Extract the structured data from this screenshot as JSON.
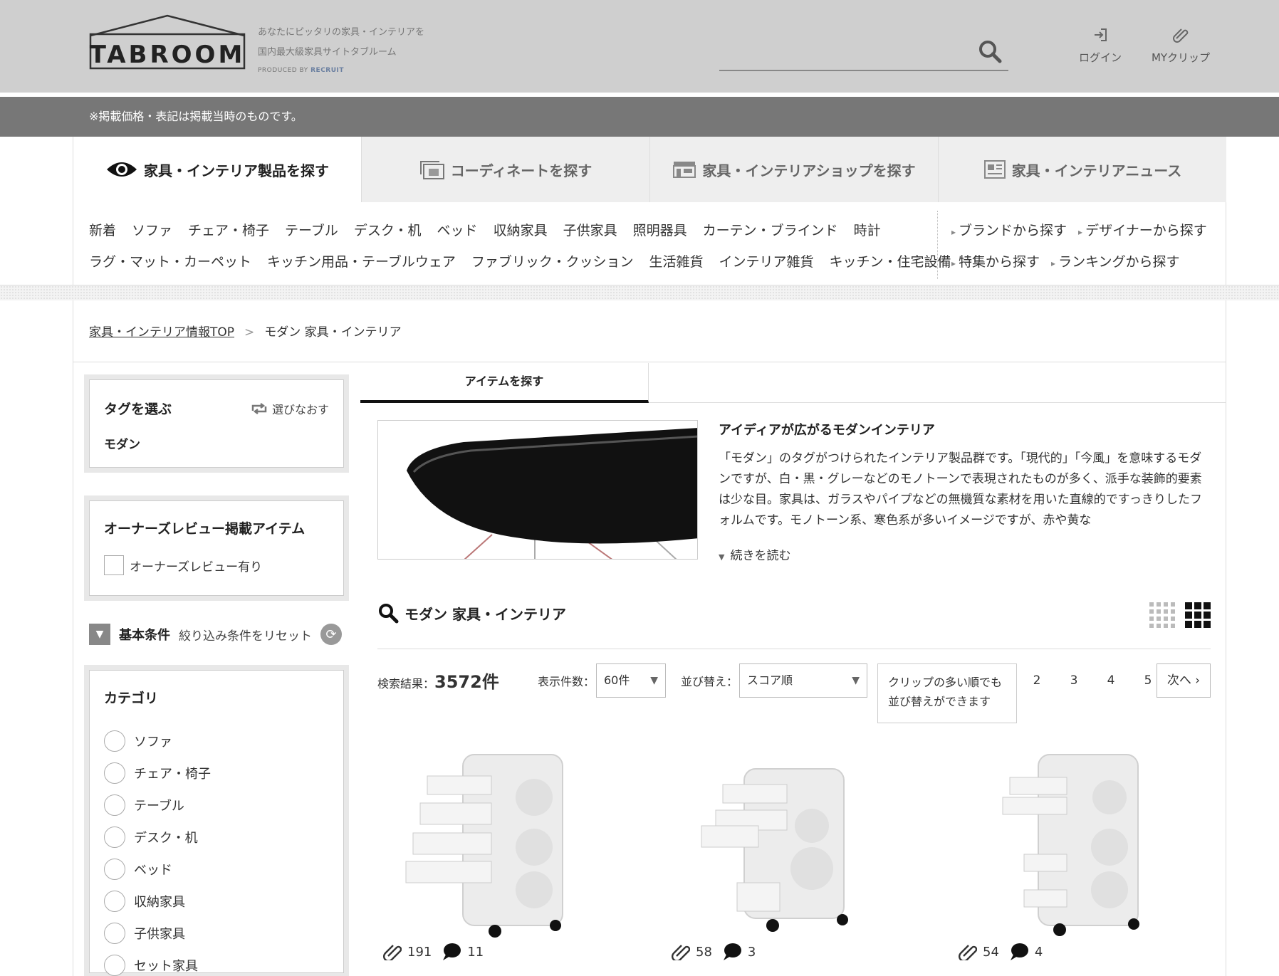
{
  "header": {
    "logo": "TABROOM",
    "tagline_1": "あなたにピッタリの家具・インテリアを",
    "tagline_2": "国内最大級家具サイトタブルーム",
    "produced_by": "PRODUCED BY",
    "produced_brand": "RECRUIT",
    "search_placeholder": "",
    "login_label": "ログイン",
    "clip_label": "MYクリップ"
  },
  "notice": "※掲載価格・表記は掲載当時のものです。",
  "nav_tabs": [
    {
      "label": "家具・インテリア製品を探す",
      "icon": "eye-icon"
    },
    {
      "label": "コーディネートを探す",
      "icon": "photo-icon"
    },
    {
      "label": "家具・インテリアショップを探す",
      "icon": "shop-icon"
    },
    {
      "label": "家具・インテリアニュース",
      "icon": "news-icon"
    }
  ],
  "categories_row1": [
    "新着",
    "ソファ",
    "チェア・椅子",
    "テーブル",
    "デスク・机",
    "ベッド",
    "収納家具",
    "子供家具",
    "照明器具",
    "カーテン・ブラインド",
    "時計"
  ],
  "categories_row2": [
    "ラグ・マット・カーペット",
    "キッチン用品・テーブルウェア",
    "ファブリック・クッション",
    "生活雑貨",
    "インテリア雑貨",
    "キッチン・住宅設備"
  ],
  "side_links_row1": [
    "ブランドから探す",
    "デザイナーから探す"
  ],
  "side_links_row2": [
    "特集から探す",
    "ランキングから探す"
  ],
  "breadcrumb": {
    "home": "家具・インテリア情報TOP",
    "sep": ">",
    "current": "モダン 家具・インテリア"
  },
  "sidebar": {
    "tag_title": "タグを選ぶ",
    "reselect": "選びなおす",
    "selected_tag": "モダン",
    "review_title": "オーナーズレビュー掲載アイテム",
    "review_option": "オーナーズレビュー有り",
    "basic_cond": "基本条件",
    "reset_label": "絞り込み条件をリセット",
    "category_title": "カテゴリ",
    "category_items": [
      "ソファ",
      "チェア・椅子",
      "テーブル",
      "デスク・机",
      "ベッド",
      "収納家具",
      "子供家具",
      "セット家具"
    ]
  },
  "main": {
    "tab_label": "アイテムを探す",
    "intro_title": "アイディアが広がるモダンインテリア",
    "intro_text": "「モダン」のタグがつけられたインテリア製品群です。「現代的」「今風」を意味するモダンですが、白・黒・グレーなどのモノトーンで表現されたものが多く、派手な装飾的要素は少な目。家具は、ガラスやパイプなどの無機質な素材を用いた直線的ですっきりしたフォルムです。モノトーン系、寒色系が多いイメージですが、赤や黄な",
    "read_more": "続きを読む",
    "result_title": "モダン 家具・インテリア",
    "count_label": "検索結果：",
    "count_value": "3572件",
    "per_page_label": "表示件数：",
    "per_page_value": "60件",
    "sort_label": "並び替え：",
    "sort_value": "スコア順",
    "tooltip_1": "クリップの多い順でも",
    "tooltip_2": "並び替えができます",
    "pages": [
      "2",
      "3",
      "4",
      "5"
    ],
    "next": "次へ"
  },
  "products": [
    {
      "clips": "191",
      "comments": "11"
    },
    {
      "clips": "58",
      "comments": "3"
    },
    {
      "clips": "54",
      "comments": "4"
    }
  ]
}
